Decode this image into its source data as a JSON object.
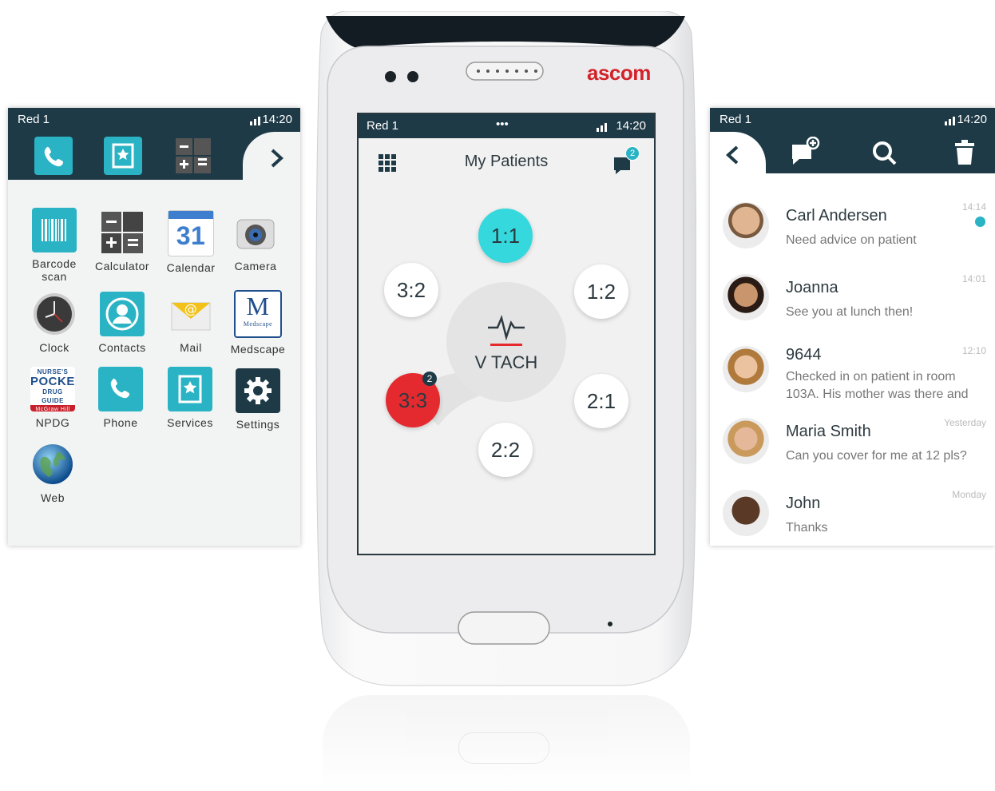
{
  "brand_color": "#1e3a47",
  "accent_color": "#2ab3c4",
  "alert_color": "#e52a2f",
  "left_screen": {
    "status": {
      "carrier": "Red 1",
      "time": "14:20"
    },
    "dock": [
      "phone-icon",
      "services-icon",
      "calculator-icon"
    ],
    "apps": [
      {
        "label": "Barcode scan",
        "icon": "barcode-icon"
      },
      {
        "label": "Calculator",
        "icon": "calculator-icon"
      },
      {
        "label": "Calendar",
        "icon": "calendar-icon",
        "day": "31"
      },
      {
        "label": "Camera",
        "icon": "camera-icon"
      },
      {
        "label": "Clock",
        "icon": "clock-icon"
      },
      {
        "label": "Contacts",
        "icon": "contacts-icon"
      },
      {
        "label": "Mail",
        "icon": "mail-icon"
      },
      {
        "label": "Medscape",
        "icon": "medscape-icon",
        "logo_letter": "M",
        "logo_text": "Medscape"
      },
      {
        "label": "NPDG",
        "icon": "npdg-icon",
        "logo_lines": [
          "NURSE'S",
          "POCKET",
          "DRUG GUIDE",
          "McGraw Hill"
        ]
      },
      {
        "label": "Phone",
        "icon": "phone-icon"
      },
      {
        "label": "Services",
        "icon": "services-icon"
      },
      {
        "label": "Settings",
        "icon": "gear-icon"
      },
      {
        "label": "Web",
        "icon": "globe-icon"
      }
    ]
  },
  "phone": {
    "brand": "ascom",
    "status": {
      "carrier": "Red 1",
      "dots": "•••",
      "time": "14:20"
    },
    "title": "My Patients",
    "chat_badge": "2",
    "center_label": "V TACH",
    "beds": [
      {
        "label": "1:1",
        "state": "active"
      },
      {
        "label": "1:2",
        "state": "normal"
      },
      {
        "label": "2:1",
        "state": "normal"
      },
      {
        "label": "2:2",
        "state": "normal"
      },
      {
        "label": "3:2",
        "state": "normal"
      },
      {
        "label": "3:3",
        "state": "alarm",
        "badge": "2"
      }
    ]
  },
  "right_screen": {
    "status": {
      "carrier": "Red 1",
      "time": "14:20"
    },
    "toolbar": [
      "back-icon",
      "new-message-icon",
      "search-icon",
      "trash-icon"
    ],
    "messages": [
      {
        "name": "Carl Andersen",
        "preview": "Need advice on patient",
        "time": "14:14",
        "unread": true
      },
      {
        "name": "Joanna",
        "preview": "See you at lunch then!",
        "time": "14:01",
        "unread": false
      },
      {
        "name": "9644",
        "preview": "Checked in on patient in room 103A. His mother was there and",
        "time": "12:10",
        "unread": false
      },
      {
        "name": "Maria Smith",
        "preview": "Can you cover for me at 12 pls?",
        "time": "Yesterday",
        "unread": false
      },
      {
        "name": "John",
        "preview": "Thanks",
        "time": "Monday",
        "unread": false
      }
    ]
  }
}
